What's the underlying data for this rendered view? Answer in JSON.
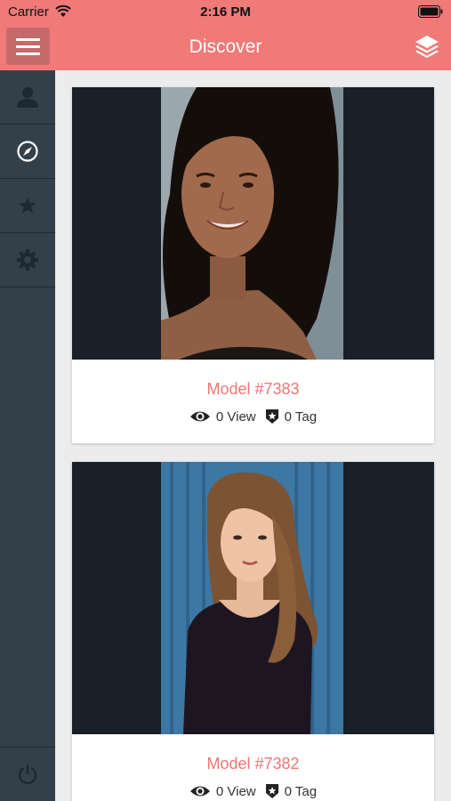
{
  "status_bar": {
    "carrier": "Carrier",
    "time": "2:16 PM"
  },
  "nav": {
    "title": "Discover",
    "menu_icon": "hamburger-icon",
    "right_icon": "layers-icon"
  },
  "sidebar": {
    "items": [
      {
        "icon": "user-icon",
        "active": false
      },
      {
        "icon": "compass-icon",
        "active": true
      },
      {
        "icon": "star-icon",
        "active": false
      },
      {
        "icon": "gear-icon",
        "active": false
      }
    ],
    "footer_icon": "power-icon"
  },
  "cards": [
    {
      "title": "Model #7383",
      "views": "0 View",
      "tags": "0 Tag"
    },
    {
      "title": "Model #7382",
      "views": "0 View",
      "tags": "0 Tag"
    }
  ],
  "colors": {
    "accent": "#f07a78",
    "sidebar": "#334049",
    "title": "#ee7672"
  }
}
